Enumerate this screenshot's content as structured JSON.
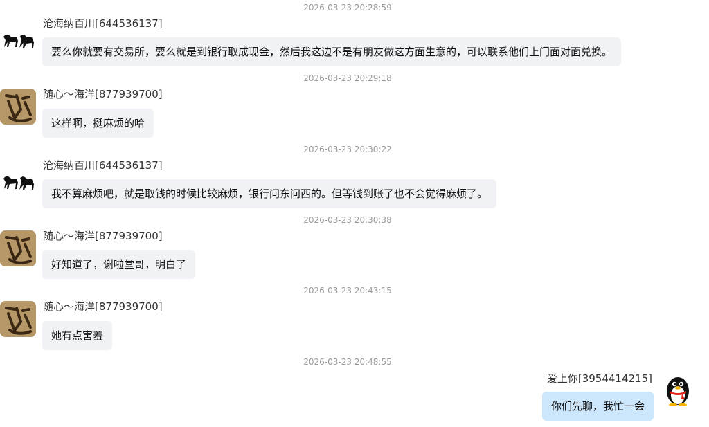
{
  "messages": [
    {
      "timestamp": "2026-03-23 20:28:59",
      "sender": "沧海纳百川[644536137]",
      "avatar": "horse-avatar",
      "text": "要么你就要有交易所，要么就是到银行取成现金，然后我这边不是有朋友做这方面生意的，可以联系他们上门面对面兑换。"
    },
    {
      "timestamp": "2026-03-23 20:29:18",
      "sender": "随心～海洋[877939700]",
      "avatar": "calligraphy-avatar",
      "text": "这样啊，挺麻烦的哈"
    },
    {
      "timestamp": "2026-03-23 20:30:22",
      "sender": "沧海纳百川[644536137]",
      "avatar": "horse-avatar",
      "text": "我不算麻烦吧，就是取钱的时候比较麻烦，银行问东问西的。但等钱到账了也不会觉得麻烦了。"
    },
    {
      "timestamp": "2026-03-23 20:30:38",
      "sender": "随心～海洋[877939700]",
      "avatar": "calligraphy-avatar",
      "text": "好知道了，谢啦堂哥，明白了"
    },
    {
      "timestamp": "2026-03-23 20:43:15",
      "sender": "随心～海洋[877939700]",
      "avatar": "calligraphy-avatar",
      "text": "她有点害羞"
    }
  ],
  "self_message": {
    "timestamp": "2026-03-23 20:48:55",
    "sender": "爱上你[3954414215]",
    "avatar": "penguin-avatar",
    "text": "你们先聊，我忙一会"
  },
  "colors": {
    "incoming_bubble": "#f0f2f5",
    "outgoing_bubble": "#cce6fb",
    "timestamp": "#9a9a9a"
  }
}
